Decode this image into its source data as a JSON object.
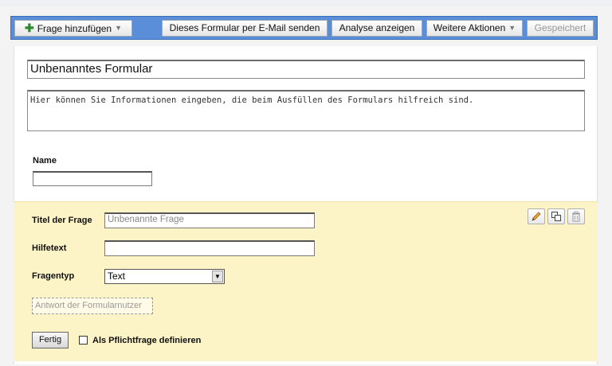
{
  "toolbar": {
    "add_question": "Frage hinzufügen",
    "email_form": "Dieses Formular per E-Mail senden",
    "show_analysis": "Analyse anzeigen",
    "more_actions": "Weitere Aktionen",
    "saved": "Gespeichert"
  },
  "form": {
    "title": "Unbenanntes Formular",
    "description": "Hier können Sie Informationen eingeben, die beim Ausfüllen des Formulars hilfreich sind.",
    "name_label": "Name"
  },
  "editor": {
    "question_title_label": "Titel der Frage",
    "question_title_value": "Unbenannte Frage",
    "help_text_label": "Hilfetext",
    "help_text_value": "",
    "question_type_label": "Fragentyp",
    "question_type_value": "Text",
    "answer_placeholder": "Antwort der Formularnutzer",
    "done_label": "Fertig",
    "required_label": "Als Pflichtfrage definieren"
  },
  "icons": {
    "edit": "pencil-icon",
    "duplicate": "duplicate-icon",
    "delete": "trash-icon"
  },
  "colors": {
    "toolbar_bg": "#5b8ed8",
    "edit_panel_bg": "#fcf3c7",
    "page_bg": "#f3f3f3"
  }
}
